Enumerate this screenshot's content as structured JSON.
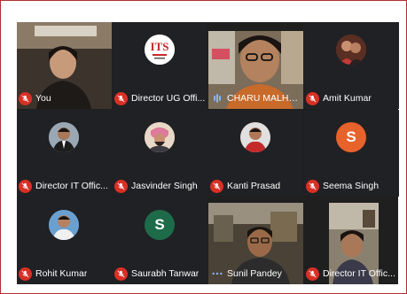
{
  "participants": [
    {
      "name": "You",
      "mic": "muted",
      "avatar": "video-woman-icon",
      "color": "#5a4a3a"
    },
    {
      "name": "Director UG Offi...",
      "mic": "muted",
      "avatar": "logo-icon",
      "color": "#ffffff"
    },
    {
      "name": "CHARU MALHO...",
      "mic": "speaking",
      "avatar": "video-woman-glasses-icon",
      "color": "#8a6a4a"
    },
    {
      "name": "Amit Kumar",
      "mic": "muted",
      "avatar": "photo-couple-icon",
      "color": "#7a4a3a"
    },
    {
      "name": "Director IT Offic...",
      "mic": "muted",
      "avatar": "photo-man-icon",
      "color": "#6a7a8a"
    },
    {
      "name": "Jasvinder Singh",
      "mic": "muted",
      "avatar": "photo-man-turban-icon",
      "color": "#c98a8a"
    },
    {
      "name": "Kanti Prasad",
      "mic": "muted",
      "avatar": "photo-man-red-icon",
      "color": "#b04040"
    },
    {
      "name": "Seema Singh",
      "mic": "muted",
      "avatar": "letter-icon",
      "letter": "S",
      "color": "#e8622c"
    },
    {
      "name": "Rohit Kumar",
      "mic": "muted",
      "avatar": "photo-man-blue-icon",
      "color": "#5a8ac0"
    },
    {
      "name": "Saurabh Tanwar",
      "mic": "muted",
      "avatar": "letter-icon",
      "letter": "S",
      "color": "#1e6b4a"
    },
    {
      "name": "Sunil Pandey",
      "mic": "more",
      "avatar": "video-man-icon",
      "color": "#5a5040"
    },
    {
      "name": "Director IT Offic...",
      "mic": "muted",
      "avatar": "video-woman-room-icon",
      "color": "#6a6055"
    }
  ],
  "colors": {
    "muted": "#d93025",
    "speaking": "#8ab4f8",
    "tile_bg": "#202124"
  }
}
